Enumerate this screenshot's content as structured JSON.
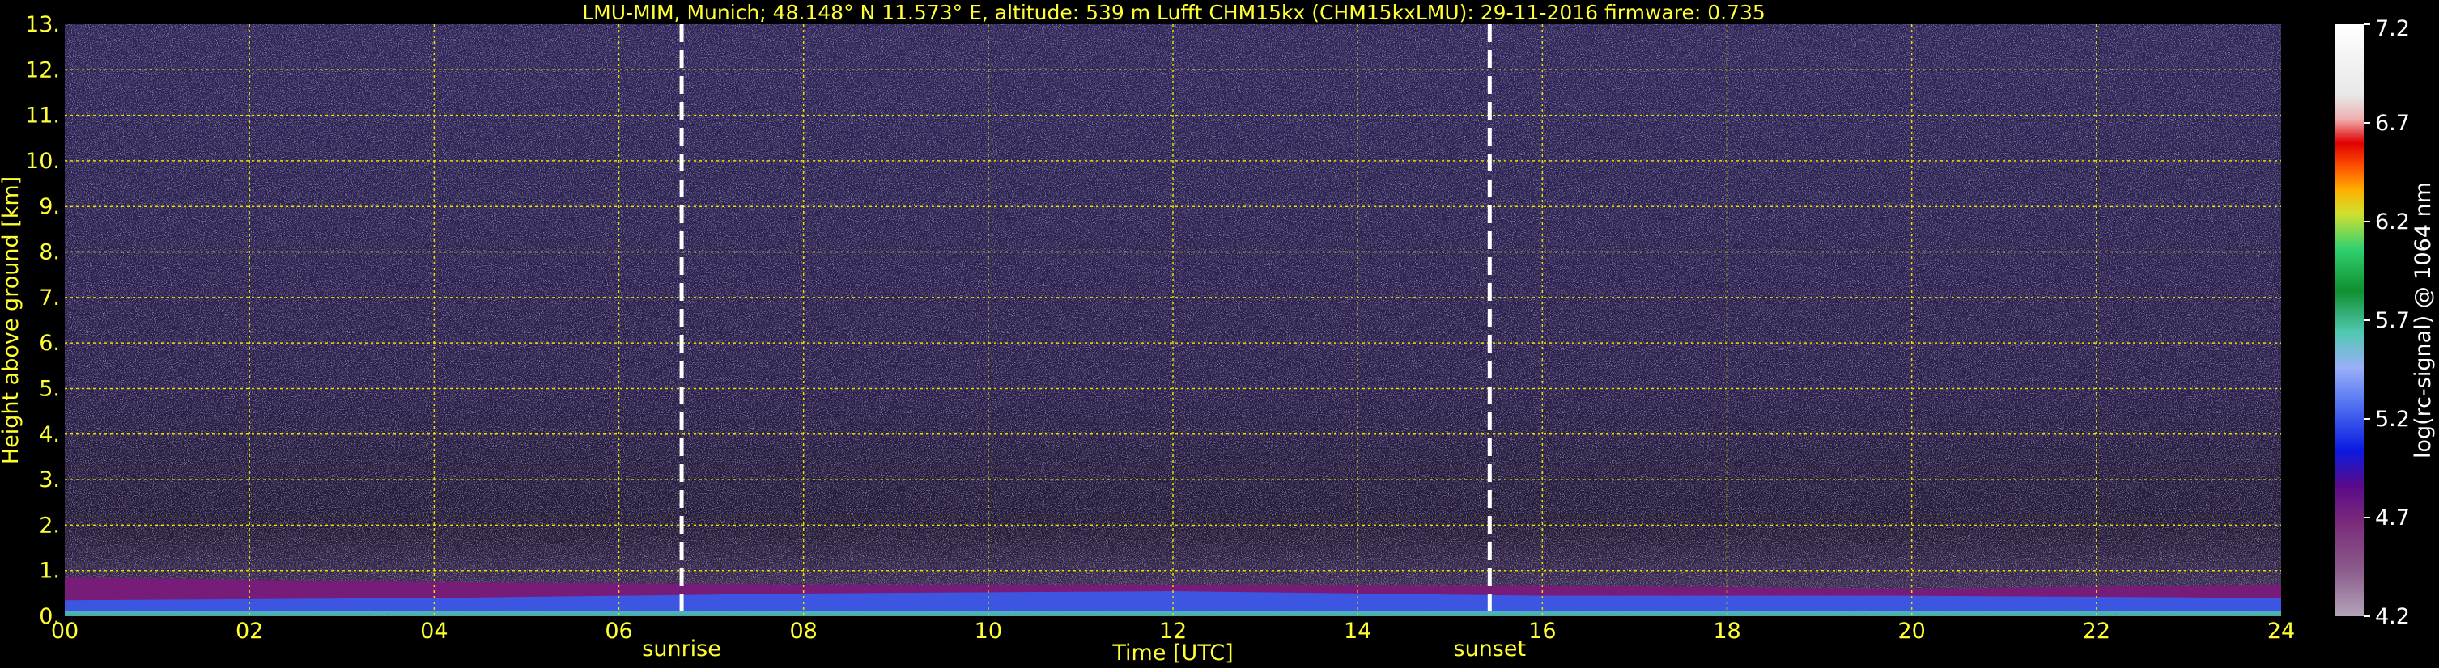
{
  "chart_data": {
    "type": "heatmap",
    "title": "LMU-MIM, Munich; 48.148° N 11.573° E, altitude: 539 m     Lufft CHM15kx (CHM15kxLMU): 29-11-2016     firmware: 0.735",
    "xlabel": "Time [UTC]",
    "ylabel": "Height above ground [km]",
    "xlim": [
      0,
      24
    ],
    "ylim": [
      0,
      13
    ],
    "x_ticks": [
      "00",
      "02",
      "04",
      "06",
      "08",
      "10",
      "12",
      "14",
      "16",
      "18",
      "20",
      "22",
      "24"
    ],
    "y_ticks": [
      "0.",
      "1.",
      "2.",
      "3.",
      "4.",
      "5.",
      "6.",
      "7.",
      "8.",
      "9.",
      "10.",
      "11.",
      "12.",
      "13."
    ],
    "grid": true,
    "annotations": [
      {
        "label": "sunrise",
        "x": 6.68
      },
      {
        "label": "sunset",
        "x": 15.43
      }
    ],
    "colorbar": {
      "label": "log(rc-signal) @ 1064 nm",
      "range": [
        4.2,
        7.2
      ],
      "ticks": [
        "4.2",
        "4.7",
        "5.2",
        "5.7",
        "6.2",
        "6.7",
        "7.2"
      ]
    },
    "boundary_layer_top_km": [
      {
        "x": 0,
        "y": 0.85
      },
      {
        "x": 4,
        "y": 0.75
      },
      {
        "x": 8,
        "y": 0.7
      },
      {
        "x": 12,
        "y": 0.7
      },
      {
        "x": 16,
        "y": 0.68
      },
      {
        "x": 20,
        "y": 0.6
      },
      {
        "x": 24,
        "y": 0.7
      }
    ],
    "aerosol_layer_top_km": [
      {
        "x": 0,
        "y": 0.35
      },
      {
        "x": 4,
        "y": 0.4
      },
      {
        "x": 8,
        "y": 0.5
      },
      {
        "x": 12,
        "y": 0.55
      },
      {
        "x": 16,
        "y": 0.45
      },
      {
        "x": 20,
        "y": 0.45
      },
      {
        "x": 24,
        "y": 0.4
      }
    ]
  },
  "colors": {
    "label_text": "#ffff33",
    "colorbar_text": "#ffffff",
    "grid": "#e8e000",
    "background": "#000000",
    "marker_line": "#ffffff"
  }
}
